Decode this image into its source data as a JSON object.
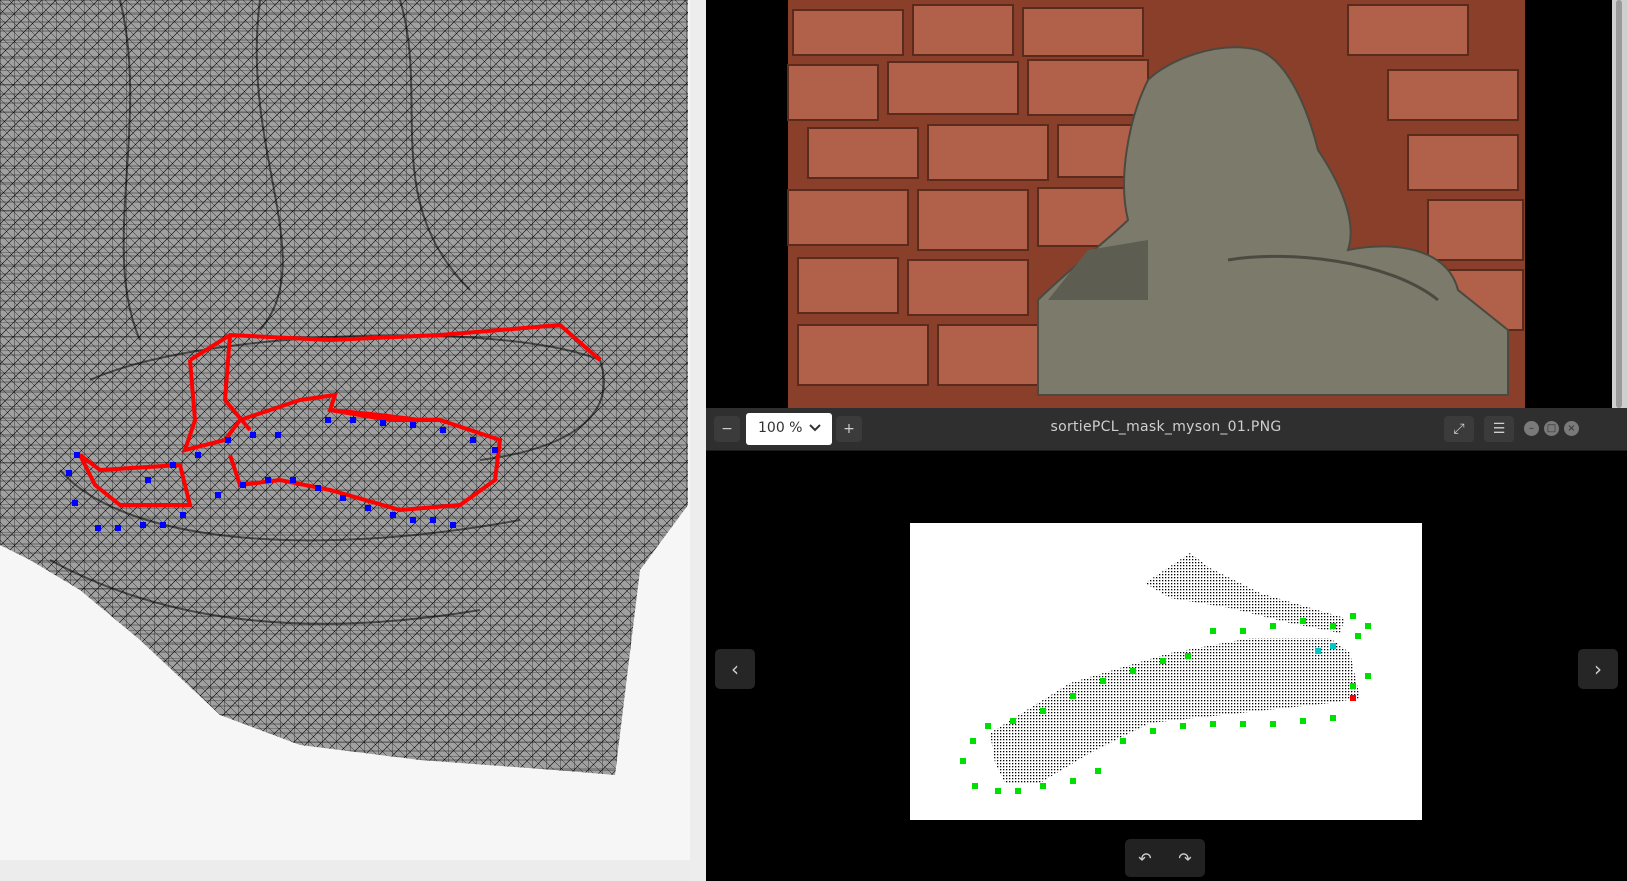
{
  "viewer": {
    "zoom_label": "100 %",
    "file_title": "sortiePCL_mask_myson_01.PNG",
    "zoom_out_icon": "minus-icon",
    "zoom_in_icon": "plus-icon",
    "fullscreen_icon": "fullscreen-icon",
    "menu_icon": "hamburger-menu-icon",
    "prev_icon": "chevron-left-icon",
    "next_icon": "chevron-right-icon",
    "rotate_left_icon": "rotate-left-icon",
    "rotate_right_icon": "rotate-right-icon"
  },
  "colors": {
    "mesh_fill": "#a0a0a0",
    "mesh_line": "#000000",
    "contour_red": "#ff0000",
    "marker_blue": "#0000ff",
    "marker_green": "#00e000",
    "marker_cyan": "#00c8c8",
    "viewer_header": "#2f2f2f",
    "brick": "#a0503a"
  }
}
